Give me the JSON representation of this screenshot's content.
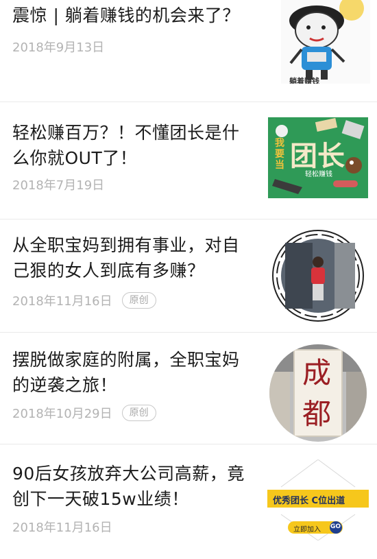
{
  "articles": [
    {
      "title": "震惊 | 躺着赚钱的机会来了？",
      "date": "2018年9月13日",
      "badge": "",
      "thumb": {
        "icon": "meme-cartoon-face",
        "caption": "躺着赚钱"
      }
    },
    {
      "title": "轻松赚百万？！不懂团长是什么你就OUT了！",
      "date": "2018年7月19日",
      "badge": "",
      "thumb": {
        "icon": "green-tuanzhang-poster",
        "main": "团长",
        "sub": "我要当",
        "tag": "轻松赚钱"
      }
    },
    {
      "title": "从全职宝妈到拥有事业，对自己狠的女人到底有多赚？",
      "date": "2018年11月16日",
      "badge": "原创",
      "thumb": {
        "icon": "woman-portrait-circle"
      }
    },
    {
      "title": "摆脱做家庭的附属，全职宝妈的逆袭之旅！",
      "date": "2018年10月29日",
      "badge": "原创",
      "thumb": {
        "icon": "chengdu-circle",
        "line1": "成",
        "line2": "都"
      }
    },
    {
      "title": "90后女孩放弃大公司高薪，竟创下一天破15w业绩！",
      "date": "2018年11月16日",
      "badge": "",
      "thumb": {
        "icon": "yellow-recruit-banner",
        "banner": "优秀团长 C位出道",
        "join": "立即加入",
        "go": "GO"
      }
    }
  ],
  "colors": {
    "title": "#1b1b1b",
    "date": "#b3b3b3",
    "separator": "#e9e9e9"
  }
}
